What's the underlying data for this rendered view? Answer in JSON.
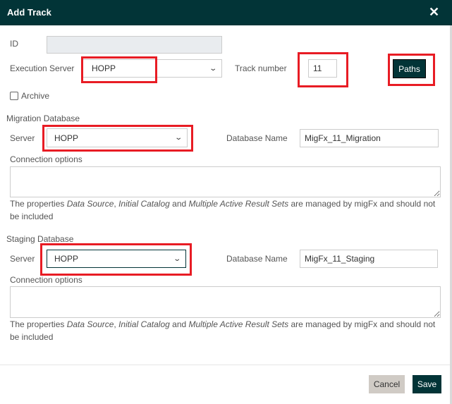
{
  "dialog": {
    "title": "Add Track",
    "close_icon": "close-icon"
  },
  "form": {
    "id_label": "ID",
    "id_value": "",
    "execution_server_label": "Execution Server",
    "execution_server_value": "HOPP",
    "track_number_label": "Track number",
    "track_number_value": "11",
    "paths_label": "Paths",
    "archive_label": "Archive",
    "archive_checked": false
  },
  "migration": {
    "section_label": "Migration Database",
    "server_label": "Server",
    "server_value": "HOPP",
    "db_name_label": "Database Name",
    "db_name_value": "MigFx_11_Migration",
    "conn_label": "Connection options",
    "conn_value": "",
    "help": {
      "p1": "The properties ",
      "i1": "Data Source",
      "p2": ", ",
      "i2": "Initial Catalog",
      "p3": " and ",
      "i3": "Multiple Active Result Sets",
      "p4": " are managed by migFx and should not be included"
    }
  },
  "staging": {
    "section_label": "Staging Database",
    "server_label": "Server",
    "server_value": "HOPP",
    "db_name_label": "Database Name",
    "db_name_value": "MigFx_11_Staging",
    "conn_label": "Connection options",
    "conn_value": "",
    "help": {
      "p1": "The properties ",
      "i1": "Data Source",
      "p2": ", ",
      "i2": "Initial Catalog",
      "p3": " and ",
      "i3": "Multiple Active Result Sets",
      "p4": " are managed by migFx and should not be included"
    }
  },
  "footer": {
    "cancel_label": "Cancel",
    "save_label": "Save"
  },
  "colors": {
    "header": "#023437",
    "highlight": "#e81c24",
    "cancel_bg": "#d0cbc5"
  }
}
